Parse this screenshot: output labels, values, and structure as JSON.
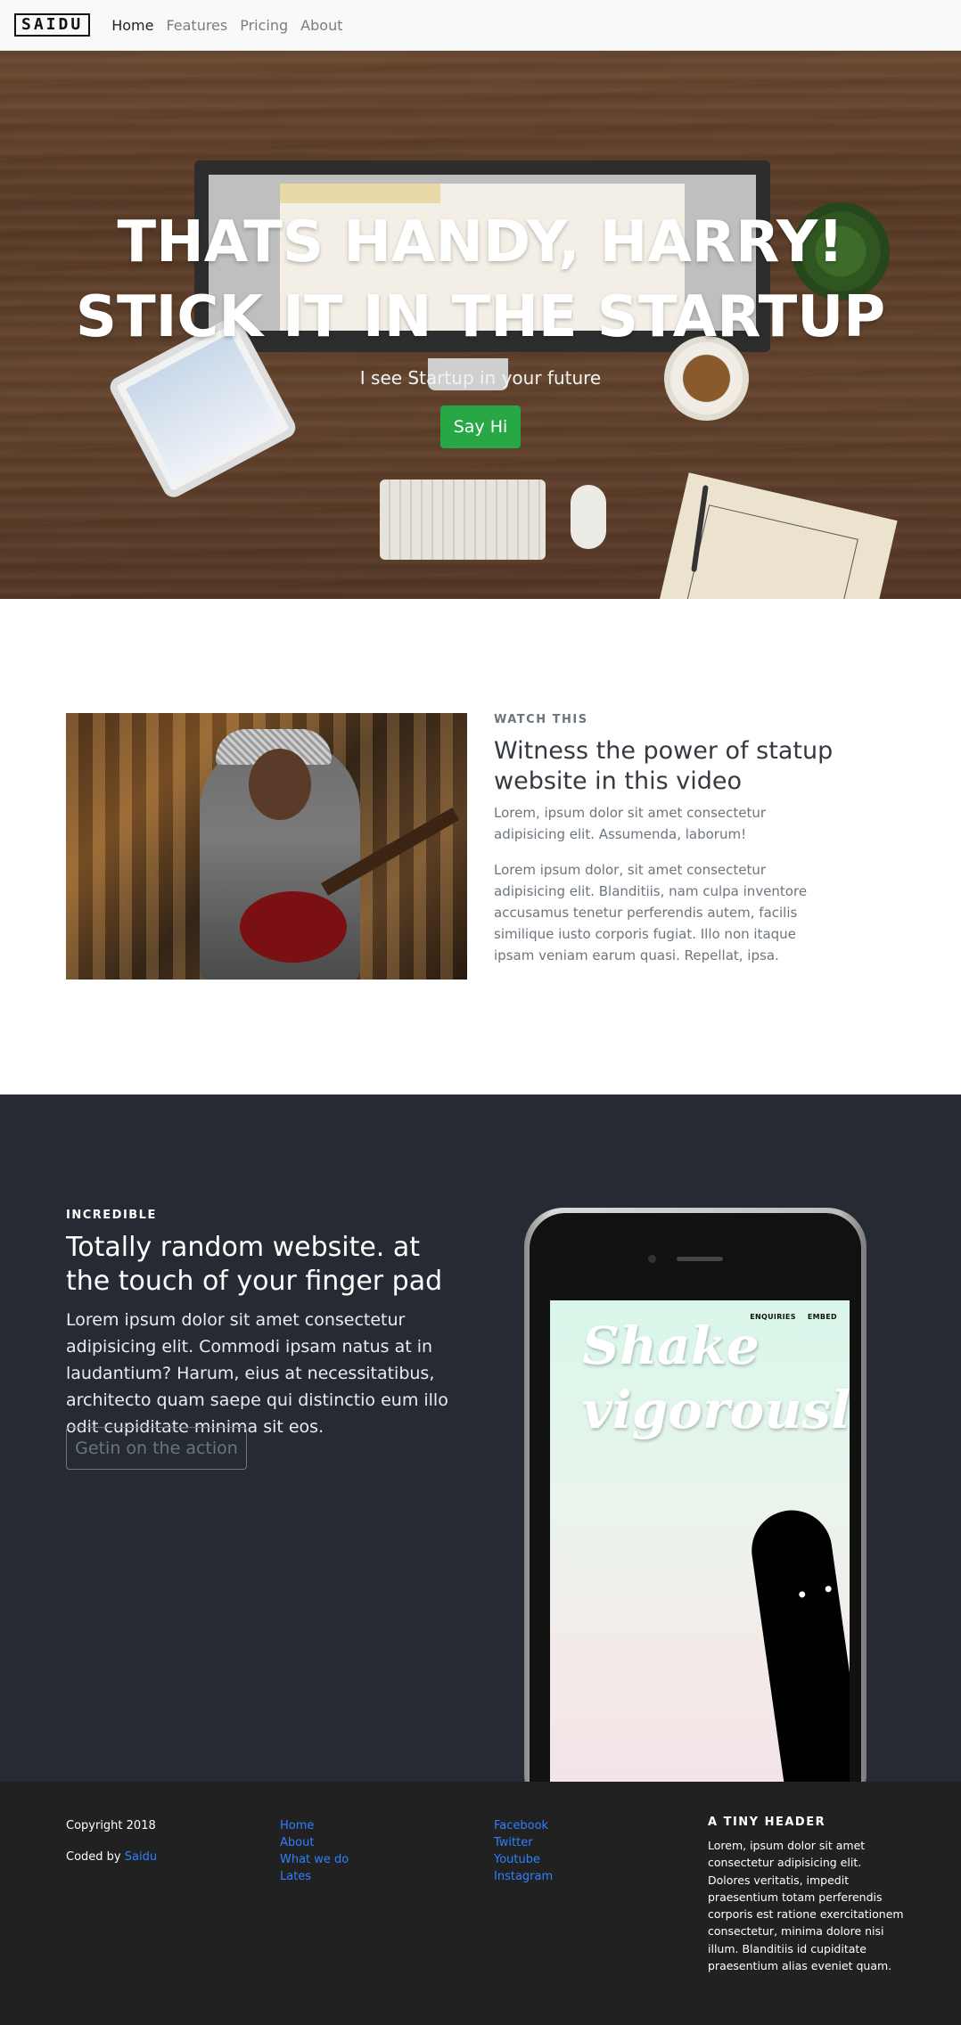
{
  "nav": {
    "brand": "SAIDU",
    "links": [
      "Home",
      "Features",
      "Pricing",
      "About"
    ]
  },
  "hero": {
    "title_line1": "THATS HANDY, HARRY!",
    "title_line2": "STICK IT IN THE STARTUP",
    "subtitle": "I see Startup in your future",
    "button": "Say Hi"
  },
  "video_section": {
    "eyebrow": "WATCH THIS",
    "title": "Witness the power of statup website in this video",
    "paragraph1": "Lorem, ipsum dolor sit amet consectetur adipisicing elit. Assumenda, laborum!",
    "paragraph2": "Lorem ipsum dolor, sit amet consectetur adipisicing elit. Blanditiis, nam culpa inventore accusamus tenetur perferendis autem, facilis similique iusto corporis fugiat. Illo non itaque ipsam veniam earum quasi. Repellat, ipsa."
  },
  "dark_section": {
    "eyebrow": "INCREDIBLE",
    "title": "Totally random website. at the touch of your finger pad",
    "lead": "Lorem ipsum dolor sit amet consectetur adipisicing elit. Commodi ipsam natus at in laudantium? Harum, eius at necessitatibus, architecto quam saepe qui distinctio eum illo odit cupiditate minima sit eos.",
    "button": "Getin on the action",
    "phone": {
      "nav_items": [
        "ENQUIRIES",
        "EMBED"
      ],
      "headline": "Shake vigorously"
    }
  },
  "footer": {
    "copyright": "Copyright 2018",
    "coded_by_prefix": "Coded by ",
    "coded_by_name": "Saidu",
    "links_col1": [
      "Home",
      "About",
      "What we do",
      "Lates"
    ],
    "links_col2": [
      "Facebook",
      "Twitter",
      "Youtube",
      "Instagram"
    ],
    "header": "A TINY HEADER",
    "paragraph": "Lorem, ipsum dolor sit amet consectetur adipisicing elit. Dolores veritatis, impedit praesentium totam perferendis corporis est ratione exercitationem consectetur, minima dolore nisi illum. Blanditiis id cupiditate praesentium alias eveniet quam."
  },
  "colors": {
    "success": "#28a745",
    "dark_bg": "#262b33",
    "footer_bg": "#212121",
    "link": "#2f80ff"
  }
}
